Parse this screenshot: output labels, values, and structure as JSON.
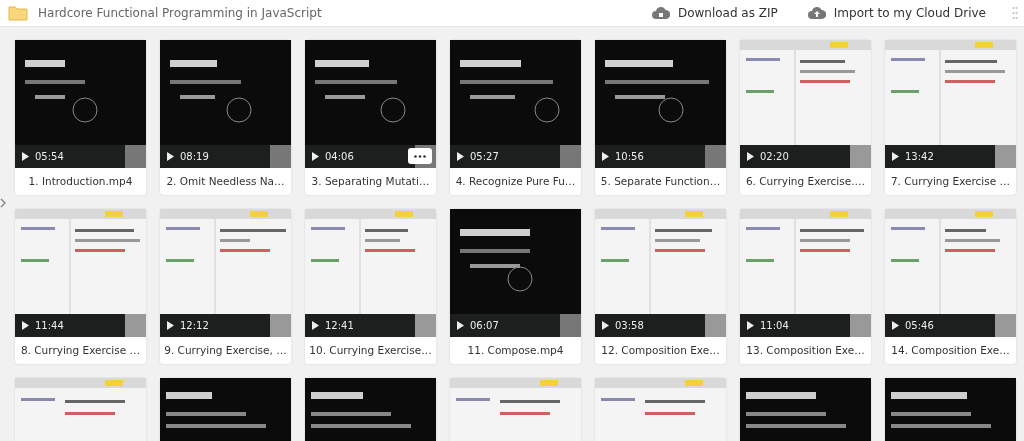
{
  "header": {
    "title": "Hardcore Functional Programming in JavaScript",
    "actions": [
      {
        "kind": "zip",
        "label": "Download as ZIP"
      },
      {
        "kind": "cloud",
        "label": "Import to my Cloud Drive"
      }
    ]
  },
  "videos": [
    {
      "duration": "05:54",
      "name": "1. Introduction.mp4",
      "menu": false
    },
    {
      "duration": "08:19",
      "name": "2. Omit Needless Na…",
      "menu": false
    },
    {
      "duration": "04:06",
      "name": "3. Separating Mutati…",
      "menu": true
    },
    {
      "duration": "05:27",
      "name": "4. Recognize Pure Fu…",
      "menu": false
    },
    {
      "duration": "10:56",
      "name": "5. Separate Function…",
      "menu": false
    },
    {
      "duration": "02:20",
      "name": "6. Currying Exercise.…",
      "menu": false
    },
    {
      "duration": "13:42",
      "name": "7. Currying Exercise …",
      "menu": false
    },
    {
      "duration": "11:44",
      "name": "8. Currying Exercise …",
      "menu": false
    },
    {
      "duration": "12:12",
      "name": "9. Currying Exercise, …",
      "menu": false
    },
    {
      "duration": "12:41",
      "name": "10. Currying Exercise…",
      "menu": false
    },
    {
      "duration": "06:07",
      "name": "11. Compose.mp4",
      "menu": false
    },
    {
      "duration": "03:58",
      "name": "12. Composition Exe…",
      "menu": false
    },
    {
      "duration": "11:04",
      "name": "13. Composition Exe…",
      "menu": false
    },
    {
      "duration": "05:46",
      "name": "14. Composition Exe…",
      "menu": false
    }
  ]
}
